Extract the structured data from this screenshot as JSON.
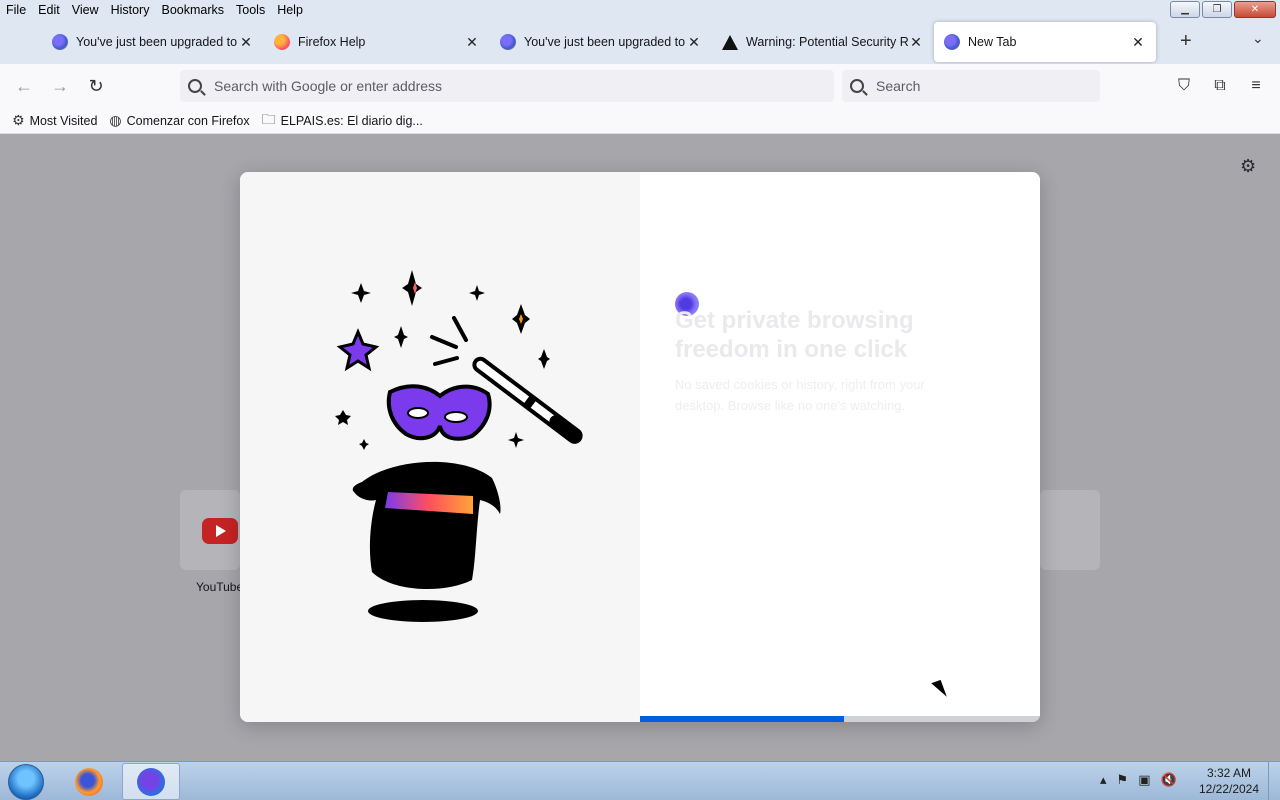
{
  "menubar": {
    "items": [
      "File",
      "Edit",
      "View",
      "History",
      "Bookmarks",
      "Tools",
      "Help"
    ],
    "accesskeys": [
      "F",
      "E",
      "V",
      "s",
      "B",
      "T",
      "H"
    ]
  },
  "tabs": [
    {
      "title": "You've just been upgraded to Fi",
      "icon": "firefox-icon"
    },
    {
      "title": "Firefox Help",
      "icon": "firefox-help-icon"
    },
    {
      "title": "You've just been upgraded to Fi",
      "icon": "firefox-icon"
    },
    {
      "title": "Warning: Potential Security Risk",
      "icon": "warning-icon"
    },
    {
      "title": "New Tab",
      "icon": "firefox-icon",
      "active": true
    }
  ],
  "navbar": {
    "url_placeholder": "Search with Google or enter address",
    "search_placeholder": "Search"
  },
  "bookmarks": [
    {
      "label": "Most Visited",
      "icon": "gear-icon"
    },
    {
      "label": "Comenzar con Firefox",
      "icon": "globe-icon"
    },
    {
      "label": "ELPAIS.es: El diario dig...",
      "icon": "folder-icon"
    }
  ],
  "newtab": {
    "shortcut_label": "YouTube"
  },
  "modal": {
    "headline": "Get private browsing freedom in one click",
    "subtext": "No saved cookies or history, right from your desktop. Browse like no one's watching.",
    "progress": 0.51
  },
  "taskbar": {
    "time": "3:32 AM",
    "date": "12/22/2024"
  },
  "colors": {
    "accent": "#0060df",
    "mask": "#7c3aed",
    "youtube": "#c42424"
  }
}
